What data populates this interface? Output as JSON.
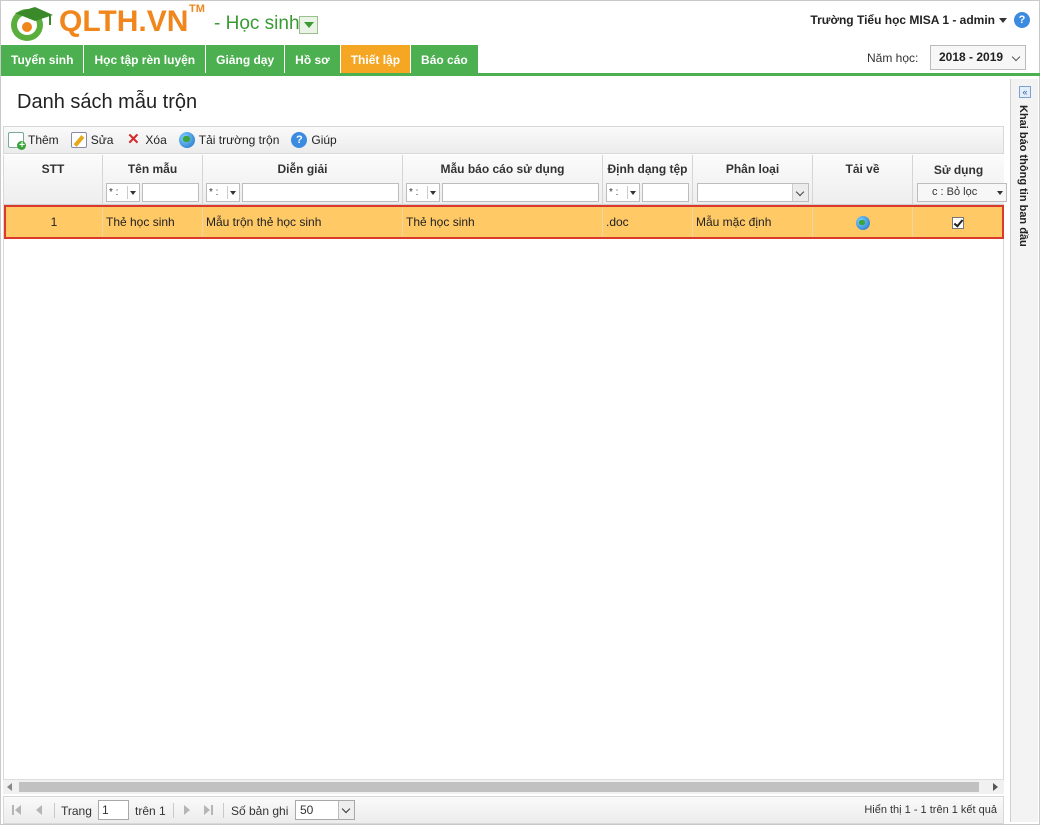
{
  "header": {
    "brand": "QLTH.VN",
    "trademark": "TM",
    "module": "- Học sinh",
    "school_user": "Trường Tiểu học MISA 1 - admin",
    "help_icon": "help-icon"
  },
  "nav": {
    "items": [
      {
        "label": "Tuyển sinh",
        "active": false
      },
      {
        "label": "Học tập rèn luyện",
        "active": false
      },
      {
        "label": "Giảng dạy",
        "active": false
      },
      {
        "label": "Hồ sơ",
        "active": false
      },
      {
        "label": "Thiết lập",
        "active": true
      },
      {
        "label": "Báo cáo",
        "active": false
      }
    ],
    "year_label": "Năm học:",
    "year_value": "2018 - 2019"
  },
  "side_panel": {
    "title": "Khai báo thông tin ban đầu",
    "collapse_label": "«"
  },
  "page": {
    "title": "Danh sách mẫu trộn"
  },
  "toolbar": {
    "add": "Thêm",
    "edit": "Sửa",
    "delete": "Xóa",
    "download_fields": "Tải trường trộn",
    "help": "Giúp",
    "delete_glyph": "✕",
    "help_glyph": "?"
  },
  "grid": {
    "columns": [
      "STT",
      "Tên mẫu",
      "Diễn giải",
      "Mẫu báo cáo sử dụng",
      "Định dạng tệp",
      "Phân loại",
      "Tải về",
      "Sử dụng"
    ],
    "filter_op": "* :",
    "filter_use": "c : Bỏ lọc",
    "rows": [
      {
        "stt": "1",
        "name": "Thẻ học sinh",
        "description": "Mẫu trộn thẻ học sinh",
        "report": "Thẻ học sinh",
        "format": ".doc",
        "category": "Mẫu mặc định",
        "download_icon": "globe-download-icon",
        "in_use": true
      }
    ]
  },
  "pager": {
    "page_label": "Trang",
    "page_value": "1",
    "of_label": "trên 1",
    "page_size_label": "Số bản ghi",
    "page_size_value": "50",
    "info": "Hiển thị 1 - 1 trên 1 kết quả"
  },
  "colors": {
    "brand_orange": "#f0861c",
    "nav_green": "#4caf50",
    "nav_active": "#f5a623",
    "row_selected": "#ffc966",
    "row_outline": "#d93a2b"
  }
}
